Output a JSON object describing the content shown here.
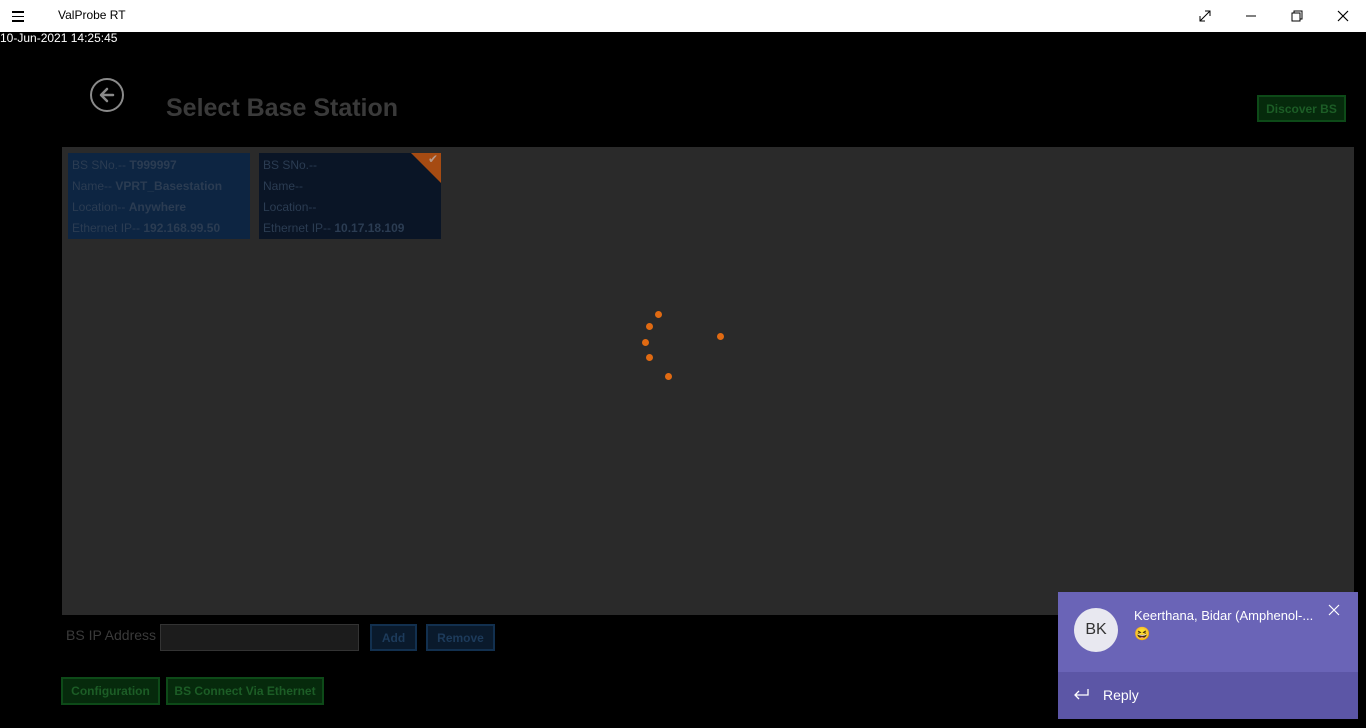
{
  "window": {
    "app_title": "ValProbe RT"
  },
  "status": {
    "datetime": "10-Jun-2021 14:25:45"
  },
  "page": {
    "title": "Select Base Station",
    "discover_label": "Discover BS"
  },
  "cards": [
    {
      "sno_label": "BS SNo.--",
      "sno_value": "T999997",
      "name_label": "Name--",
      "name_value": "VPRT_Basestation",
      "location_label": "Location--",
      "location_value": "Anywhere",
      "ip_label": "Ethernet IP--",
      "ip_value": "192.168.99.50",
      "selected": false
    },
    {
      "sno_label": "BS SNo.--",
      "sno_value": "",
      "name_label": "Name--",
      "name_value": "",
      "location_label": "Location--",
      "location_value": "",
      "ip_label": "Ethernet IP--",
      "ip_value": "10.17.18.109",
      "selected": true
    }
  ],
  "ip_form": {
    "label": "BS IP Address",
    "value": "",
    "add_label": "Add",
    "remove_label": "Remove"
  },
  "footer": {
    "configuration_label": "Configuration",
    "connect_label": "BS Connect Via Ethernet"
  },
  "toast": {
    "initials": "BK",
    "sender": "Keerthana, Bidar (Amphenol-...",
    "message": "😆",
    "reply_label": "Reply"
  },
  "colors": {
    "spinner": "#e06a12",
    "toast_bg": "#6a64b7",
    "accent_green": "#1c5d26"
  }
}
